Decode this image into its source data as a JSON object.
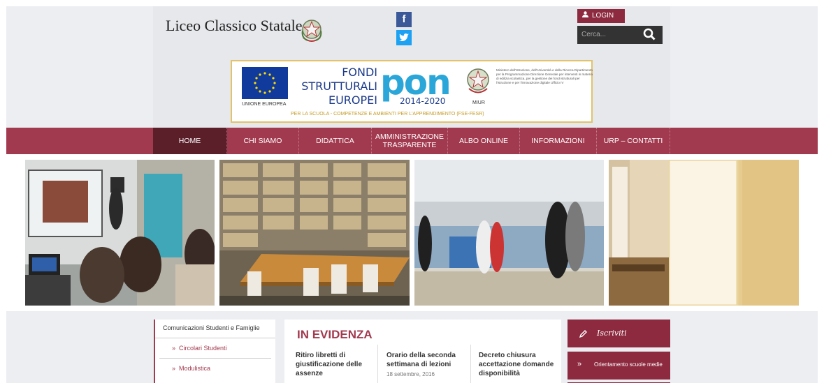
{
  "header": {
    "site_title": "Liceo Classico Statale",
    "facebook_glyph": "f",
    "twitter_glyph": "t",
    "login_label": "LOGIN",
    "search_placeholder": "Cerca..."
  },
  "banner": {
    "fondi_lines": [
      "FONDI",
      "STRUTTURALI",
      "EUROPEI"
    ],
    "eu_label": "UNIONE EUROPEA",
    "pon": "pon",
    "pon_years": "2014-2020",
    "miur_label": "MIUR",
    "ministry_text": "Ministero dell'Istruzione, dell'Università e della Ricerca Dipartimento per la Programmazione Direzione Generale per interventi in materia di edilizia scolastica, per la gestione dei fondi strutturali per l'istruzione e per l'innovazione digitale Ufficio IV",
    "footer": "PER LA SCUOLA - COMPETENZE E AMBIENTI PER L'APPRENDIMENTO (FSE-FESR)"
  },
  "nav": {
    "items": [
      {
        "label": "HOME",
        "active": true
      },
      {
        "label": "CHI SIAMO",
        "active": false
      },
      {
        "label": "DIDATTICA",
        "active": false
      },
      {
        "label": "AMMINISTRAZIONE TRASPARENTE",
        "active": false
      },
      {
        "label": "ALBO ONLINE",
        "active": false
      },
      {
        "label": "INFORMAZIONI",
        "active": false
      },
      {
        "label": "URP – CONTATTI",
        "active": false
      }
    ]
  },
  "sidebar": {
    "heading": "Comunicazioni Studenti e Famiglie",
    "links": [
      "Circolari Studenti",
      "Modulistica"
    ]
  },
  "evidenza": {
    "title": "IN EVIDENZA",
    "news": [
      {
        "title": "Ritiro libretti di giustificazione delle assenze",
        "date": ""
      },
      {
        "title": "Orario della seconda settimana di lezioni",
        "date": "18 settembre, 2016"
      },
      {
        "title": "Decreto chiusura accettazione domande disponibilità",
        "date": ""
      }
    ]
  },
  "right_panel": {
    "iscriviti_label": "Iscriviti",
    "orientamento_label": "Orientamento scuole medie"
  },
  "colors": {
    "brand": "#a23a4f",
    "brand_dark": "#8d2a3f",
    "nav_active": "#5b1f2a"
  }
}
